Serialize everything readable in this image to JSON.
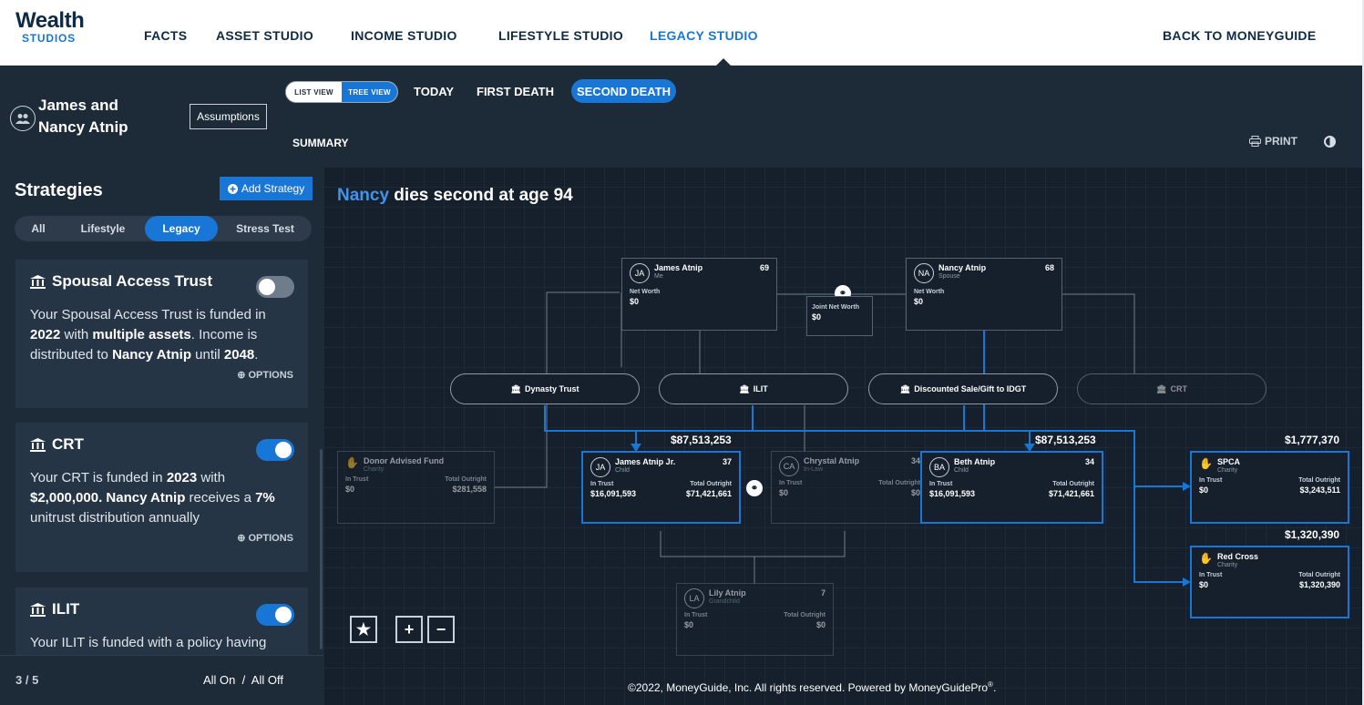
{
  "nav": {
    "logo_top": "Wealth",
    "logo_bottom": "STUDIOS",
    "items": [
      "FACTS",
      "ASSET STUDIO",
      "INCOME STUDIO",
      "LIFESTYLE STUDIO",
      "LEGACY STUDIO"
    ],
    "active": "LEGACY STUDIO",
    "back": "BACK TO MONEYGUIDE"
  },
  "header": {
    "client_name": "James and Nancy Atnip",
    "assumptions": "Assumptions",
    "list_view": "LIST VIEW",
    "tree_view": "TREE VIEW",
    "today": "TODAY",
    "first_death": "FIRST DEATH",
    "second_death": "SECOND DEATH",
    "summary": "SUMMARY",
    "print": "PRINT"
  },
  "sidebar": {
    "title": "Strategies",
    "add_strategy": "Add Strategy",
    "filters": [
      "All",
      "Lifestyle",
      "Legacy",
      "Stress Test"
    ],
    "active_filter": "Legacy",
    "options_label": "OPTIONS",
    "cards": [
      {
        "title": "Spousal Access Trust",
        "enabled": false
      },
      {
        "title": "CRT",
        "enabled": true
      },
      {
        "title": "ILIT",
        "enabled": true
      }
    ],
    "card1": {
      "t1": "Your Spousal Access Trust is funded in ",
      "b1": "2022",
      "t2": " with ",
      "b2": "multiple assets",
      "t3": ". Income is distributed to ",
      "b3": "Nancy Atnip",
      "t4": " until ",
      "b4": "2048",
      "t5": "."
    },
    "card2": {
      "t1": "Your CRT is funded in ",
      "b1": "2023",
      "t2": " with ",
      "b2": "$2,000,000.",
      "t3": " ",
      "b3": "Nancy Atnip",
      "t4": " receives a ",
      "b4": "7%",
      "t5": " unitrust distribution annually"
    },
    "card3": {
      "t1": "Your ILIT is funded with a policy having"
    },
    "count": "3 / 5",
    "all_on": "All On",
    "sep": "/",
    "all_off": "All Off"
  },
  "tree": {
    "title_name": "Nancy",
    "title_rest": " dies second at age 94",
    "labels": {
      "net_worth": "Net Worth",
      "joint_net_worth": "Joint Net Worth",
      "in_trust": "In Trust",
      "total_outright": "Total Outright"
    },
    "james": {
      "initials": "JA",
      "name": "James Atnip",
      "role": "Me",
      "age": "69",
      "net_worth": "$0"
    },
    "nancy": {
      "initials": "NA",
      "name": "Nancy Atnip",
      "role": "Spouse",
      "age": "68",
      "net_worth": "$0"
    },
    "joint": {
      "value": "$0"
    },
    "strategies": [
      "Dynasty Trust",
      "ILIT",
      "Discounted Sale/Gift to IDGT",
      "CRT"
    ],
    "donor": {
      "name": "Donor Advised Fund",
      "role": "Charity",
      "in_trust": "$0",
      "total_outright": "$281,558"
    },
    "james_jr": {
      "initials": "JA",
      "name": "James Atnip Jr.",
      "role": "Child",
      "age": "37",
      "in_trust": "$16,091,593",
      "total_outright": "$71,421,661",
      "amount": "$87,513,253"
    },
    "chrystal": {
      "initials": "CA",
      "name": "Chrystal Atnip",
      "role": "In-Law",
      "age": "34",
      "in_trust": "$0",
      "total_outright": "$0"
    },
    "beth": {
      "initials": "BA",
      "name": "Beth Atnip",
      "role": "Child",
      "age": "34",
      "in_trust": "$16,091,593",
      "total_outright": "$71,421,661",
      "amount": "$87,513,253"
    },
    "spca": {
      "name": "SPCA",
      "role": "Charity",
      "in_trust": "$0",
      "total_outright": "$3,243,511",
      "amount": "$1,777,370"
    },
    "redcross": {
      "name": "Red Cross",
      "role": "Charity",
      "in_trust": "$0",
      "total_outright": "$1,320,390",
      "amount": "$1,320,390"
    },
    "lily": {
      "initials": "LA",
      "name": "Lily Atnip",
      "role": "Grandchild",
      "age": "7",
      "in_trust": "$0",
      "total_outright": "$0"
    }
  },
  "footer": {
    "text": "©2022, MoneyGuide, Inc. All rights reserved. Powered by MoneyGuidePro",
    "mark": "®",
    "end": "."
  },
  "colors": {
    "accent": "#1877d6",
    "dark": "#1d2a38",
    "canvas": "#15202c",
    "gold": "#f0b429"
  }
}
